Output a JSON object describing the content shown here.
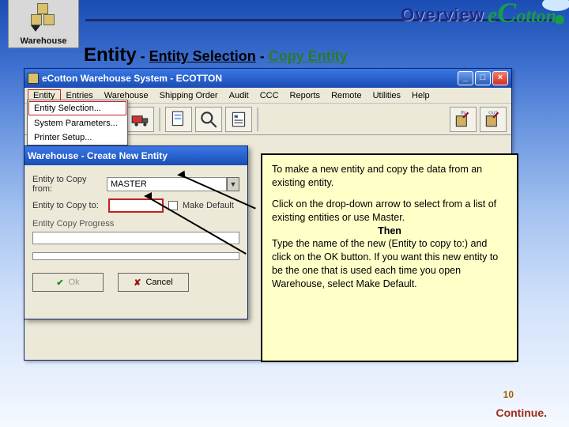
{
  "header": {
    "warehouse_label": "Warehouse",
    "overview_label": "Overview",
    "brand_e": "e",
    "brand_c": "C",
    "brand_rest": "otton"
  },
  "breadcrumb": {
    "p1": "Entity",
    "sep": " - ",
    "p2": "Entity Selection",
    "p3": "Copy Entity"
  },
  "appwin": {
    "title": "eCotton  Warehouse  System - ECOTTON",
    "menu": [
      "Entity",
      "Entries",
      "Warehouse",
      "Shipping Order",
      "Audit",
      "CCC",
      "Reports",
      "Remote",
      "Utilities",
      "Help"
    ],
    "dropdown": {
      "item1": "Entity Selection...",
      "item2": "System Parameters...",
      "item3": "Printer Setup..."
    },
    "toolbar_icons": [
      "in-icon",
      "clipboard-icon",
      "truck-icon",
      "truck-red-icon",
      "sheet-icon",
      "magnify-icon",
      "report-icon",
      "bale-in-icon",
      "bale-out-icon"
    ]
  },
  "dialog": {
    "title": "Warehouse - Create New Entity",
    "copy_from_label": "Entity to Copy from:",
    "copy_from_value": "MASTER",
    "copy_to_label": "Entity to Copy to:",
    "copy_to_value": "",
    "make_default_label": "Make Default",
    "progress_label": "Entity Copy Progress",
    "ok_label": "Ok",
    "cancel_label": "Cancel"
  },
  "tip": {
    "p1": "To make a new entity and copy the data from an existing entity.",
    "p2a": "Click on the drop-down arrow to select from a list of existing entities or use Master.",
    "then": "Then",
    "p2b": "Type the name of the new (Entity to copy to:) and click on the OK button. If you want this new entity to be the one that is used each time you open Warehouse, select Make Default."
  },
  "footer": {
    "page": "10",
    "continue": "Continue."
  }
}
